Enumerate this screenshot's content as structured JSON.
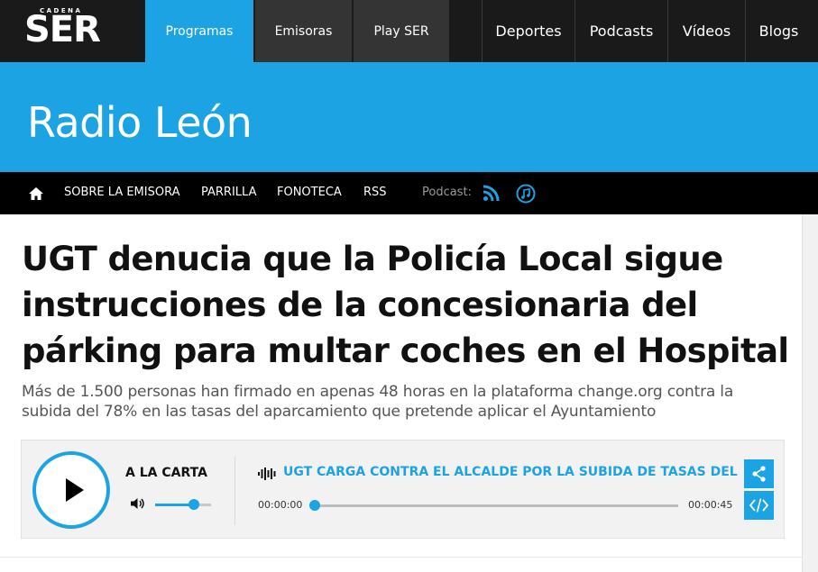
{
  "topnav": {
    "logo_top": "CADENA",
    "logo_main": "SER",
    "tabs": [
      {
        "label": "Programas"
      },
      {
        "label": "Emisoras"
      },
      {
        "label": "Play SER"
      }
    ],
    "links": [
      {
        "label": "Deportes"
      },
      {
        "label": "Podcasts"
      },
      {
        "label": "Vídeos"
      },
      {
        "label": "Blogs"
      }
    ]
  },
  "banner": {
    "station": "Radio León"
  },
  "subnav": {
    "items": [
      {
        "label": "SOBRE LA EMISORA"
      },
      {
        "label": "PARRILLA"
      },
      {
        "label": "FONOTECA"
      },
      {
        "label": "RSS"
      }
    ],
    "podcast_label": "Podcast:",
    "icons": [
      "home-icon",
      "rss-feed-icon",
      "itunes-icon"
    ]
  },
  "article": {
    "headline": "UGT denucia que la Policía Local sigue instrucciones de la concesionaria del párking para multar coches en el Hospital",
    "summary": "Más de 1.500 personas han firmado en apenas 48 horas en la plataforma change.org contra la subida del 78% en las tasas del aparcamiento que pretende aplicar el Ayuntamiento"
  },
  "player": {
    "mode_label": "A LA CARTA",
    "track_title": "UGT CARGA CONTRA EL ALCALDE POR LA SUBIDA DE TASAS DEL",
    "time_current": "00:00:00",
    "time_total": "00:00:45",
    "progress": 0.0,
    "volume": 0.7,
    "accent_color": "#1ba3e3"
  },
  "colors": {
    "brand_blue": "#1ba3e3",
    "nav_dark": "#1a1a1a",
    "tab_gray": "#343434"
  }
}
